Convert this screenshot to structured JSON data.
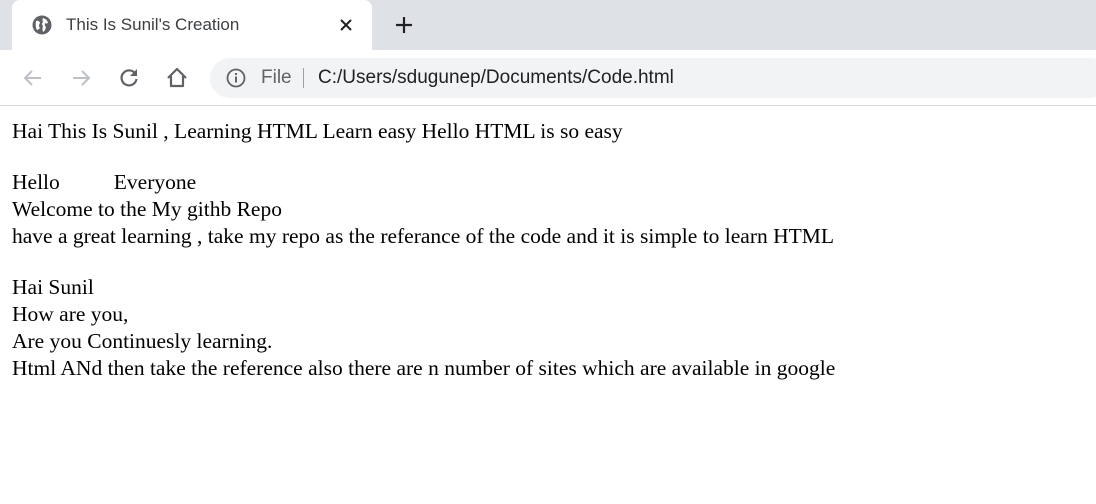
{
  "browser": {
    "tab": {
      "title": "This Is Sunil's Creation"
    },
    "address_bar": {
      "scheme_label": "File",
      "url": "C:/Users/sdugunep/Documents/Code.html"
    }
  },
  "page": {
    "line1": "Hai This Is Sunil , Learning HTML Learn easy Hello HTML is so easy",
    "hello": "Hello",
    "everyone": "Everyone",
    "welcome": "Welcome to the My githb Repo",
    "great_learning": "have a great learning , take my repo as the referance of the code and it is simple to learn HTML",
    "hai_sunil": "Hai Sunil",
    "how_are_you": "How are you,",
    "are_you": "Are you Continuesly learning.",
    "html_line": "Html ANd then take the reference also there are n number of sites which are available in google"
  }
}
